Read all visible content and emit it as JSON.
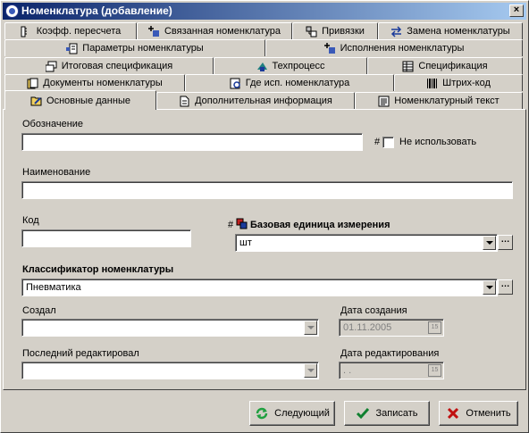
{
  "window": {
    "title": "Номенклатура (добавление)",
    "close": "×"
  },
  "tabs": {
    "row1": [
      {
        "label": "Коэфф. пересчета",
        "icon": "ruler-icon"
      },
      {
        "label": "Связанная номенклатура",
        "icon": "plus-link-icon"
      },
      {
        "label": "Привязки",
        "icon": "binding-icon"
      },
      {
        "label": "Замена номенклатуры",
        "icon": "swap-arrows-icon"
      }
    ],
    "row2": [
      {
        "label": "Параметры номенклатуры",
        "icon": "parameters-icon"
      },
      {
        "label": "Исполнения номенклатуры",
        "icon": "plus-link-icon"
      }
    ],
    "row3": [
      {
        "label": "Итоговая спецификация",
        "icon": "windows-icon"
      },
      {
        "label": "Техпроцесс",
        "icon": "process-icon"
      },
      {
        "label": "Спецификация",
        "icon": "table-icon"
      }
    ],
    "row4": [
      {
        "label": "Документы номенклатуры",
        "icon": "documents-icon"
      },
      {
        "label": "Где исп. номенклатура",
        "icon": "where-used-icon"
      },
      {
        "label": "Штрих-код",
        "icon": "barcode-icon"
      }
    ],
    "row5": [
      {
        "label": "Основные данные",
        "icon": "folder-edit-icon",
        "active": true
      },
      {
        "label": "Дополнительная информация",
        "icon": "document-icon"
      },
      {
        "label": "Номенклатурный текст",
        "icon": "text-doc-icon"
      }
    ]
  },
  "form": {
    "designation_label": "Обозначение",
    "designation_value": "",
    "hash_mark": "#",
    "not_use_label": "Не использовать",
    "name_label": "Наименование",
    "name_value": "",
    "code_label": "Код",
    "code_value": "",
    "base_unit_hash": "#",
    "base_unit_label": "Базовая единица измерения",
    "base_unit_value": "шт",
    "classifier_label": "Классификатор номенклатуры",
    "classifier_value": "Пневматика",
    "created_by_label": "Создал",
    "created_by_value": "",
    "created_date_label": "Дата создания",
    "created_date_value": "01.11.2005",
    "last_edited_label": "Последний редактировал",
    "last_edited_value": "",
    "edit_date_label": "Дата редактирования",
    "edit_date_value": ". .",
    "ellipsis": "…",
    "calendar_glyph": "15"
  },
  "buttons": {
    "next": "Следующий",
    "save": "Записать",
    "cancel": "Отменить"
  }
}
